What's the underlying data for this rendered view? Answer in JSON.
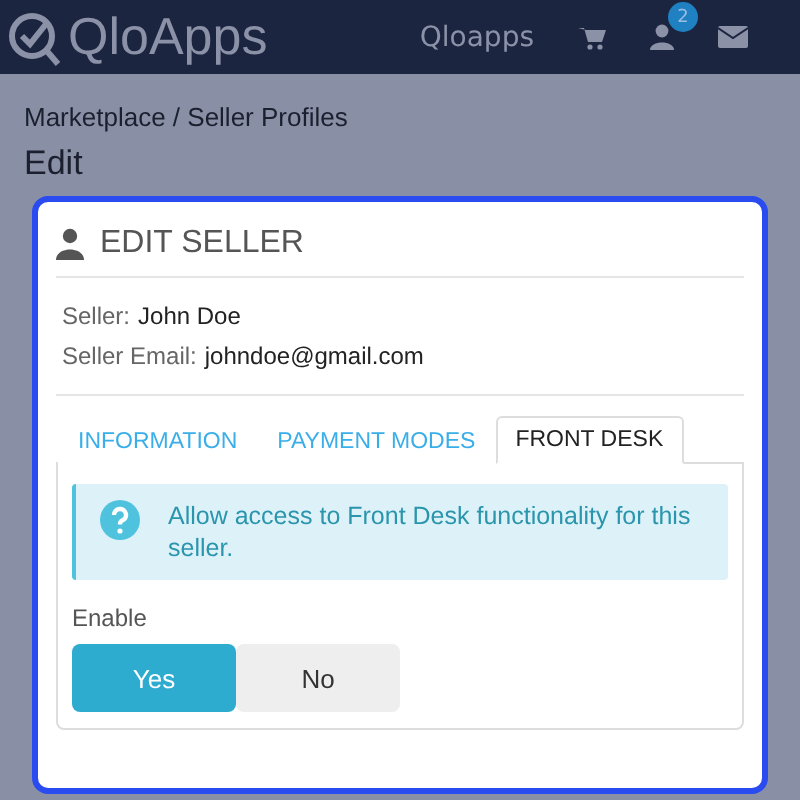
{
  "header": {
    "logo": "QloApps",
    "shop_link": "Qloapps",
    "notification_count": "2"
  },
  "breadcrumb": "Marketplace / Seller Profiles",
  "page_title": "Edit",
  "panel": {
    "title": "EDIT SELLER",
    "fields": [
      {
        "label": "Seller:",
        "value": "John Doe"
      },
      {
        "label": "Seller Email:",
        "value": "johndoe@gmail.com"
      }
    ],
    "tabs": [
      {
        "label": "INFORMATION",
        "selected": false
      },
      {
        "label": "PAYMENT MODES",
        "selected": false
      },
      {
        "label": "FRONT DESK",
        "selected": true
      }
    ],
    "alert": "Allow access to Front Desk functionality for this seller.",
    "toggle": {
      "label": "Enable",
      "options": [
        {
          "label": "Yes",
          "selected": true
        },
        {
          "label": "No",
          "selected": false
        }
      ]
    }
  }
}
